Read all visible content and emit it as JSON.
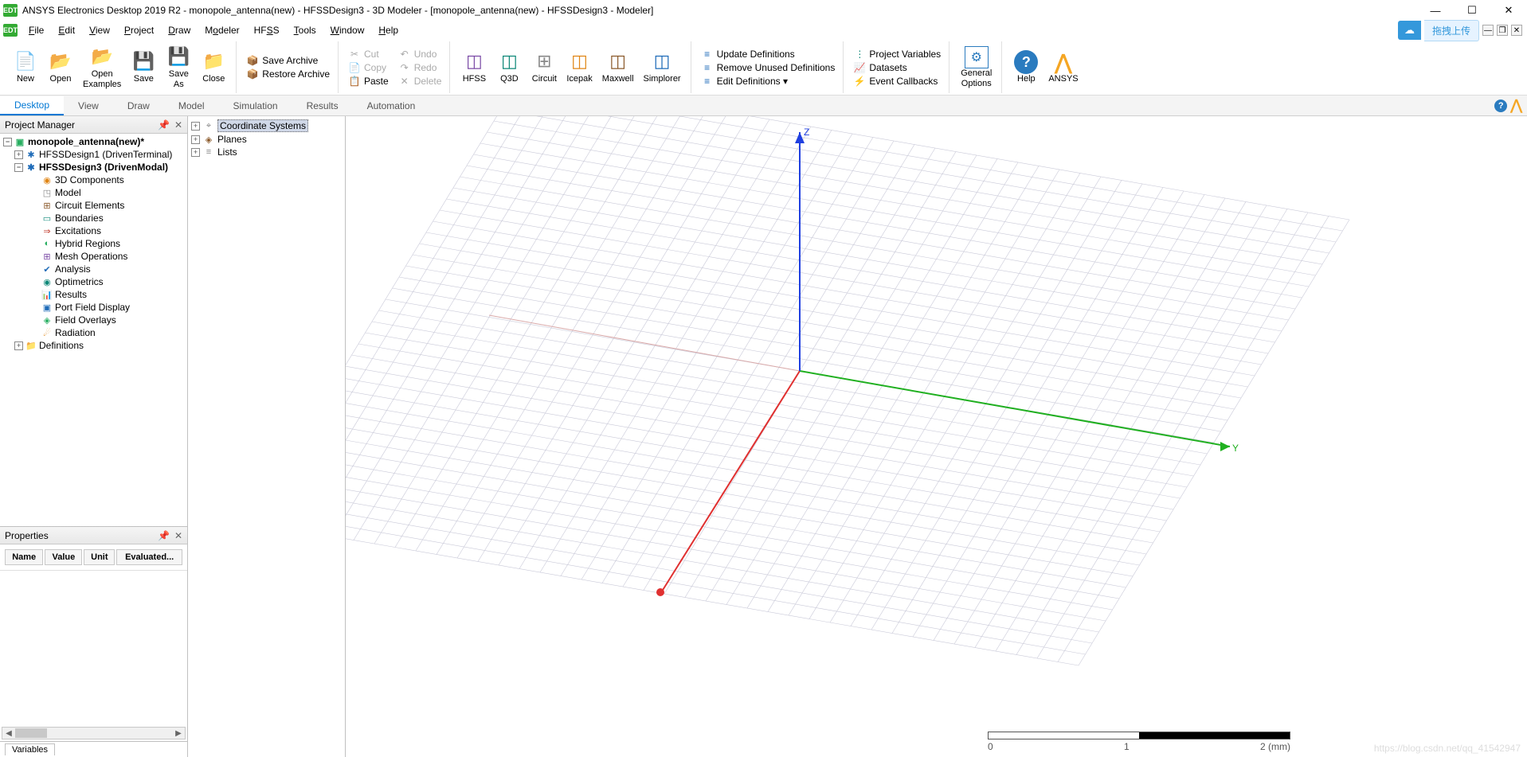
{
  "window": {
    "title": "ANSYS Electronics Desktop 2019 R2 - monopole_antenna(new) - HFSSDesign3 - 3D Modeler - [monopole_antenna(new) - HFSSDesign3 - Modeler]",
    "badge": "EDT",
    "minimize": "—",
    "maximize": "☐",
    "close": "✕"
  },
  "menu": {
    "items": [
      "File",
      "Edit",
      "View",
      "Project",
      "Draw",
      "Modeler",
      "HFSS",
      "Tools",
      "Window",
      "Help"
    ],
    "cloud_icon": "☁",
    "cloud_text": "拖拽上传",
    "mini": [
      "—",
      "❐",
      "✕"
    ]
  },
  "ribbon": {
    "file": {
      "new": "New",
      "open": "Open",
      "open_examples": "Open\nExamples",
      "save": "Save",
      "save_as": "Save\nAs",
      "close": "Close"
    },
    "archive": {
      "save": "Save Archive",
      "restore": "Restore Archive"
    },
    "clipboard": {
      "cut": "Cut",
      "copy": "Copy",
      "paste": "Paste",
      "undo": "Undo",
      "redo": "Redo",
      "delete": "Delete"
    },
    "tools": {
      "hfss": "HFSS",
      "q3d": "Q3D",
      "circuit": "Circuit",
      "icepak": "Icepak",
      "maxwell": "Maxwell",
      "simplorer": "Simplorer"
    },
    "defs": {
      "update": "Update Definitions",
      "remove": "Remove Unused Definitions",
      "edit": "Edit Definitions ▾"
    },
    "proj": {
      "vars": "Project Variables",
      "datasets": "Datasets",
      "events": "Event Callbacks"
    },
    "general": "General\nOptions",
    "help": "Help",
    "ansys": "ANSYS"
  },
  "tabs": [
    "Desktop",
    "View",
    "Draw",
    "Model",
    "Simulation",
    "Results",
    "Automation"
  ],
  "project_manager": {
    "title": "Project Manager",
    "root": "monopole_antenna(new)*",
    "design1": "HFSSDesign1 (DrivenTerminal)",
    "design3": "HFSSDesign3 (DrivenModal)",
    "nodes": [
      "3D Components",
      "Model",
      "Circuit Elements",
      "Boundaries",
      "Excitations",
      "Hybrid Regions",
      "Mesh Operations",
      "Analysis",
      "Optimetrics",
      "Results",
      "Port Field Display",
      "Field Overlays",
      "Radiation"
    ],
    "definitions": "Definitions"
  },
  "properties": {
    "title": "Properties",
    "cols": [
      "Name",
      "Value",
      "Unit",
      "Evaluated..."
    ],
    "variables_tab": "Variables"
  },
  "model_tree": {
    "items": [
      "Coordinate Systems",
      "Planes",
      "Lists"
    ]
  },
  "viewport": {
    "axis_z": "Z",
    "axis_y": "Y",
    "ruler": {
      "l0": "0",
      "l1": "1",
      "l2": "2 (mm)"
    }
  },
  "watermark": "https://blog.csdn.net/qq_41542947"
}
